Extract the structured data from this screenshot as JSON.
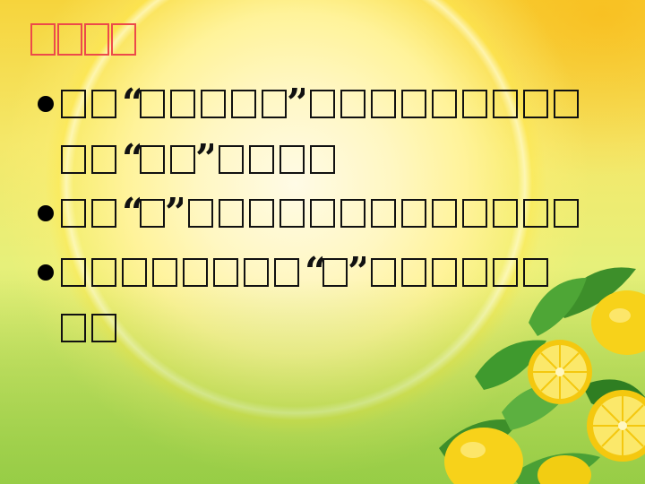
{
  "slide": {
    "title": "□□□□",
    "bullets": [
      {
        "lines": [
          [
            {
              "t": "g"
            },
            {
              "t": "g"
            },
            {
              "t": "q",
              "v": "“"
            },
            {
              "t": "g"
            },
            {
              "t": "g"
            },
            {
              "t": "g"
            },
            {
              "t": "g"
            },
            {
              "t": "g"
            },
            {
              "t": "q",
              "v": "”"
            },
            {
              "t": "g"
            },
            {
              "t": "g"
            },
            {
              "t": "g"
            },
            {
              "t": "g"
            },
            {
              "t": "g"
            },
            {
              "t": "g"
            },
            {
              "t": "g"
            },
            {
              "t": "g"
            },
            {
              "t": "g"
            }
          ],
          [
            {
              "t": "g"
            },
            {
              "t": "g"
            },
            {
              "t": "q",
              "v": "“"
            },
            {
              "t": "g"
            },
            {
              "t": "g"
            },
            {
              "t": "q",
              "v": "”"
            },
            {
              "t": "g"
            },
            {
              "t": "g"
            },
            {
              "t": "g"
            },
            {
              "t": "g"
            }
          ]
        ]
      },
      {
        "lines": [
          [
            {
              "t": "g"
            },
            {
              "t": "g"
            },
            {
              "t": "q",
              "v": "“"
            },
            {
              "t": "g"
            },
            {
              "t": "q",
              "v": "”"
            },
            {
              "t": "g"
            },
            {
              "t": "g"
            },
            {
              "t": "g"
            },
            {
              "t": "g"
            },
            {
              "t": "g"
            },
            {
              "t": "g"
            },
            {
              "t": "g"
            },
            {
              "t": "g"
            },
            {
              "t": "g"
            },
            {
              "t": "g"
            },
            {
              "t": "g"
            },
            {
              "t": "g"
            },
            {
              "t": "g"
            }
          ]
        ]
      },
      {
        "lines": [
          [
            {
              "t": "g"
            },
            {
              "t": "g"
            },
            {
              "t": "g"
            },
            {
              "t": "g"
            },
            {
              "t": "g"
            },
            {
              "t": "g"
            },
            {
              "t": "g"
            },
            {
              "t": "g"
            },
            {
              "t": "q",
              "v": "“"
            },
            {
              "t": "g"
            },
            {
              "t": "q",
              "v": "”"
            },
            {
              "t": "g"
            },
            {
              "t": "g"
            },
            {
              "t": "g"
            },
            {
              "t": "g"
            },
            {
              "t": "g"
            },
            {
              "t": "g"
            }
          ],
          [
            {
              "t": "g"
            },
            {
              "t": "g"
            }
          ]
        ]
      }
    ]
  },
  "colors": {
    "title": "#ec4a4a",
    "text": "#111111",
    "background_top": "#f6d43c",
    "background_bottom": "#a8d455",
    "lemon": "#f7d21a",
    "leaf": "#3d8f2a"
  },
  "decor": {
    "icon": "lemon-leaves-illustration"
  }
}
